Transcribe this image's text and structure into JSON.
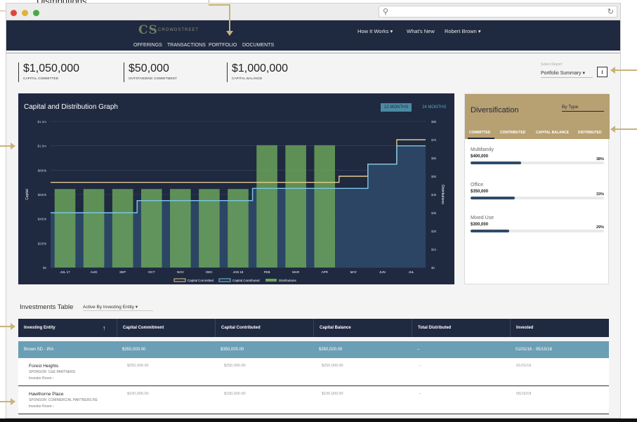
{
  "annotation": {
    "top_label": "Distributions"
  },
  "browser": {
    "search_icon": "search-icon",
    "reload_icon": "reload-icon"
  },
  "site": {
    "logo_mark": "CS",
    "logo_text": "CROWDSTREET",
    "nav": [
      "OFFERINGS",
      "TRANSACTIONS",
      "PORTFOLIO",
      "DOCUMENTS"
    ],
    "top_menu": {
      "how_it_works": "How It Works ▾",
      "whats_new": "What's New",
      "user": "Robert Brown ▾"
    }
  },
  "kpis": [
    {
      "value": "$1,050,000",
      "label": "CAPITAL COMMITTED"
    },
    {
      "value": "$50,000",
      "label": "OUTSTANDING COMMITMENT"
    },
    {
      "value": "$1,000,000",
      "label": "CAPITAL BALANCE"
    }
  ],
  "report": {
    "label": "Select Report",
    "value": "Portfolio Summary ▾",
    "download_icon": "download-icon"
  },
  "chart_panel": {
    "title": "Capital and Distribution Graph",
    "toggle_12": "12 MONTHS",
    "toggle_24": "24 MONTHS"
  },
  "chart_data": {
    "type": "bar",
    "categories": [
      "JUL 17",
      "AUG",
      "SEP",
      "OCT",
      "NOV",
      "DEC",
      "JAN 18",
      "FEB",
      "MAR",
      "APR",
      "MAY",
      "JUN",
      "JUL"
    ],
    "ylabel": "Capital",
    "y2label": "Distributions",
    "ylim": [
      0,
      1200000
    ],
    "y_ticks": [
      "$0",
      "$200k",
      "$400k",
      "$600k",
      "$800k",
      "$1.0m",
      "$1.2m"
    ],
    "y2lim": [
      0,
      8000
    ],
    "y2_ticks": [
      "$0",
      "$1k",
      "$2k",
      "$3k",
      "$4k",
      "$5k",
      "$6k",
      "$7k",
      "$8k"
    ],
    "series": [
      {
        "name": "Capital Committed",
        "kind": "step",
        "color": "#e6c98a",
        "values": [
          700000,
          700000,
          700000,
          700000,
          700000,
          700000,
          700000,
          700000,
          700000,
          700000,
          750000,
          850000,
          1050000
        ]
      },
      {
        "name": "Capital Contributed",
        "kind": "step",
        "color": "#7ec6e6",
        "values": [
          450000,
          450000,
          450000,
          550000,
          550000,
          550000,
          550000,
          650000,
          650000,
          650000,
          650000,
          850000,
          1000000
        ]
      },
      {
        "name": "Distributions",
        "kind": "bar",
        "color": "#6aa25a",
        "values": [
          4300,
          4300,
          4300,
          4300,
          4300,
          4300,
          4300,
          6700,
          6700,
          6700,
          0,
          0,
          0
        ]
      }
    ],
    "legend": [
      "Capital Committed",
      "Capital Contributed",
      "Distributions"
    ]
  },
  "diversification": {
    "title": "Diversification",
    "select": "By Type",
    "tabs": [
      "COMMITTED",
      "CONTRIBUTED",
      "CAPITAL BALANCE",
      "DISTRIBUTED"
    ],
    "items": [
      {
        "category": "Multifamily",
        "amount": "$400,000",
        "percent": "38%",
        "fraction": 0.38
      },
      {
        "category": "Office",
        "amount": "$350,000",
        "percent": "33%",
        "fraction": 0.33
      },
      {
        "category": "Mixed Use",
        "amount": "$300,000",
        "percent": "29%",
        "fraction": 0.29
      }
    ]
  },
  "investments": {
    "title": "Investments Table",
    "filter": "Active By Investing Entity ▾",
    "columns": [
      "Investing Entity",
      "Capital Commitment",
      "Capital Contributed",
      "Capital Balance",
      "Total Distributed",
      "Invested"
    ],
    "sort_icon": "↑",
    "group": {
      "entity": "Brown SD - IRA",
      "commitment": "$350,000.00",
      "contributed": "$350,000.00",
      "balance": "$350,000.00",
      "distributed": "–",
      "invested": "01/01/16 - 05/15/18"
    },
    "rows": [
      {
        "name": "Forest Heights",
        "sponsor": "SPONSOR: C&E PARTNERS",
        "room": "Investor Room ›",
        "commitment": "$250,000.00",
        "contributed": "$250,000.00",
        "balance": "$250,000.00",
        "distributed": "–",
        "invested": "01/01/16"
      },
      {
        "name": "Hawthorne Place",
        "sponsor": "SPONSOR: COMMERCIAL PARTNERS RE",
        "room": "Investor Room ›",
        "commitment": "$100,000.00",
        "contributed": "$100,000.00",
        "balance": "$100,000.00",
        "distributed": "–",
        "invested": "05/15/18"
      }
    ]
  }
}
